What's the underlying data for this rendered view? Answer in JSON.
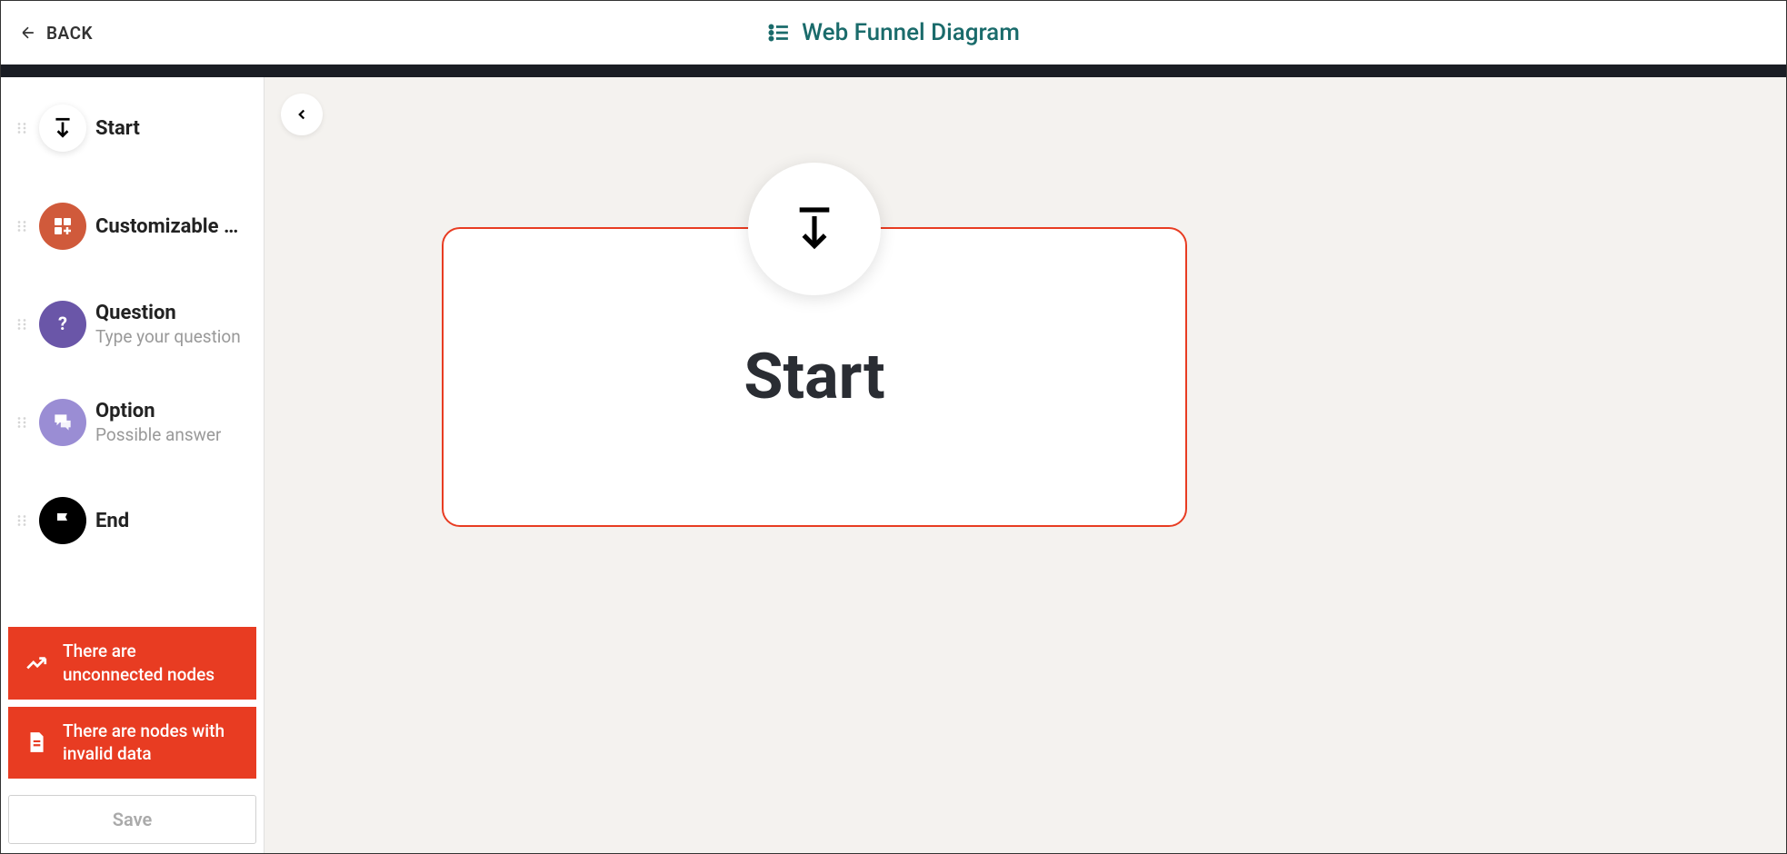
{
  "header": {
    "back_label": "BACK",
    "title": "Web Funnel Diagram"
  },
  "sidebar": {
    "items": [
      {
        "label": "Start",
        "sublabel": ""
      },
      {
        "label": "Customizable …",
        "sublabel": ""
      },
      {
        "label": "Question",
        "sublabel": "Type your question"
      },
      {
        "label": "Option",
        "sublabel": "Possible answer"
      },
      {
        "label": "End",
        "sublabel": ""
      }
    ],
    "warnings": [
      "There are unconnected nodes",
      "There are nodes with invalid data"
    ],
    "save_label": "Save"
  },
  "canvas": {
    "start_node_label": "Start"
  }
}
